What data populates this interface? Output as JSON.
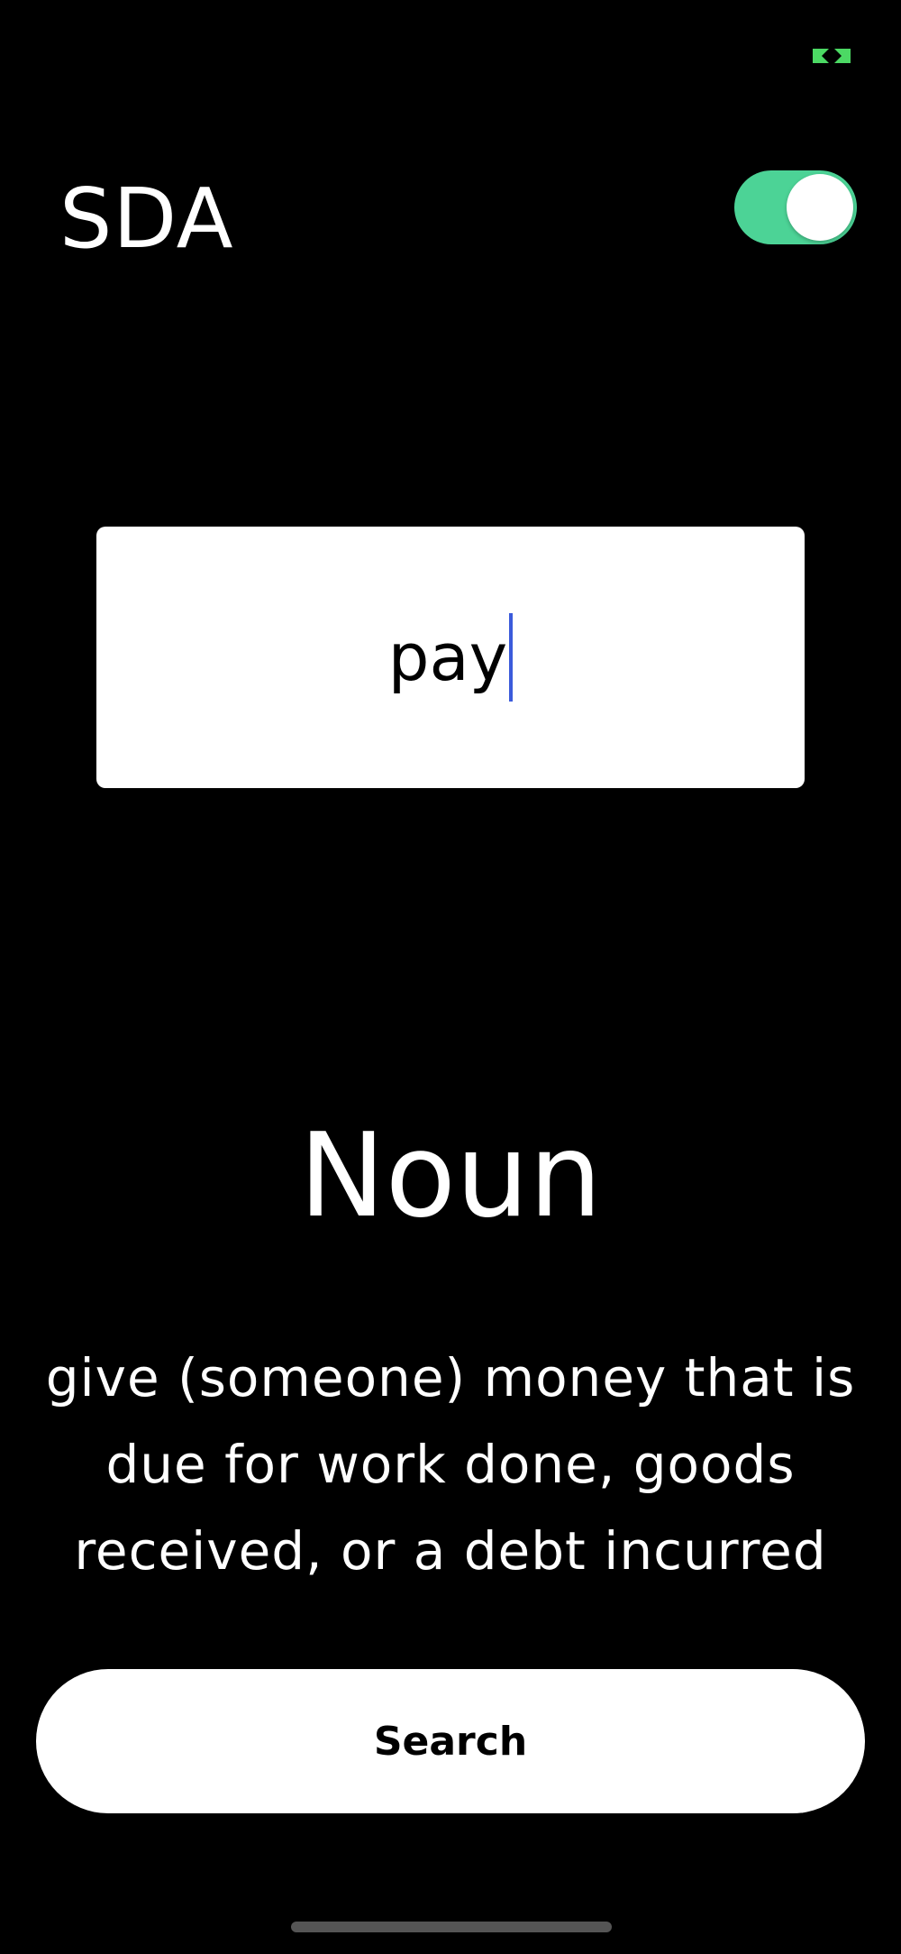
{
  "app": {
    "title": "SDA"
  },
  "toggle": {
    "state": "on",
    "color": "#4cd396"
  },
  "input": {
    "value": "pay",
    "caret_color": "#3b5bdb"
  },
  "result": {
    "part_of_speech": "Noun",
    "definition": "give (someone) money that is due for work done, goods received, or a debt incurred"
  },
  "search_button": {
    "label": "Search"
  },
  "status_bar": {
    "indicator_icon": "connection-arrows-icon",
    "indicator_color": "#4cd964"
  }
}
